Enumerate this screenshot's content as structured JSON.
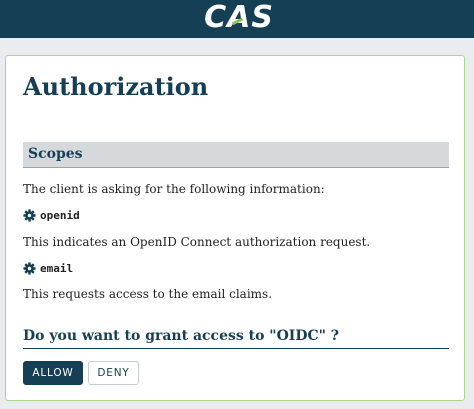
{
  "header": {
    "logo_text": "CAS"
  },
  "page": {
    "title": "Authorization"
  },
  "scopes_section": {
    "title": "Scopes",
    "intro": "The client is asking for the following information:",
    "items": [
      {
        "name": "openid",
        "icon": "gear-icon",
        "description": "This indicates an OpenID Connect authorization request."
      },
      {
        "name": "email",
        "icon": "gear-icon",
        "description": "This requests access to the email claims."
      }
    ]
  },
  "prompt": {
    "question": "Do you want to grant access to \"OIDC\" ?"
  },
  "actions": {
    "allow_label": "ALLOW",
    "deny_label": "DENY"
  },
  "colors": {
    "brand": "#153f54",
    "accent": "#8fc54d",
    "card_border": "#a9d88a",
    "section_bg": "#d5d9dc"
  }
}
